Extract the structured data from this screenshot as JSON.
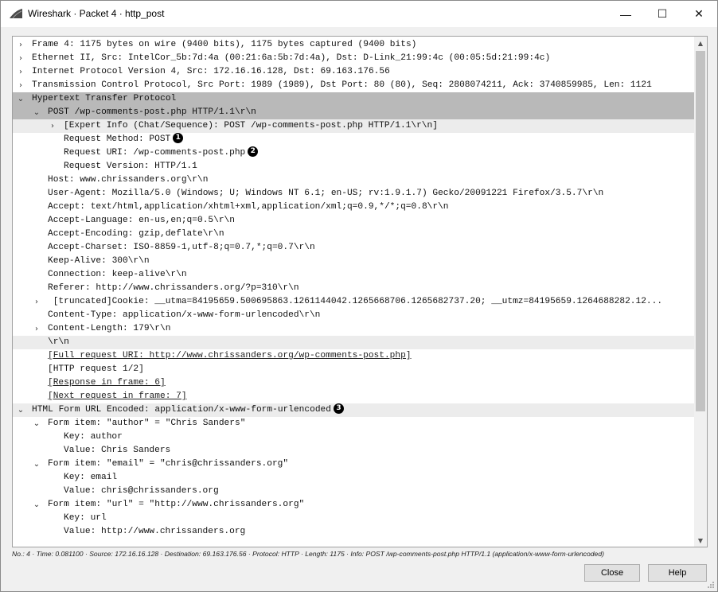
{
  "window": {
    "title": "Wireshark · Packet 4 · http_post",
    "icon": "wireshark-fin-icon",
    "controls": {
      "minimize": "—",
      "maximize": "☐",
      "close": "✕"
    }
  },
  "tree": {
    "rows": [
      {
        "indent": 0,
        "toggle": "›",
        "text": "Frame 4: 1175 bytes on wire (9400 bits), 1175 bytes captured (9400 bits)"
      },
      {
        "indent": 0,
        "toggle": "›",
        "text": "Ethernet II, Src: IntelCor_5b:7d:4a (00:21:6a:5b:7d:4a), Dst: D-Link_21:99:4c (00:05:5d:21:99:4c)"
      },
      {
        "indent": 0,
        "toggle": "›",
        "text": "Internet Protocol Version 4, Src: 172.16.16.128, Dst: 69.163.176.56"
      },
      {
        "indent": 0,
        "toggle": "›",
        "text": "Transmission Control Protocol, Src Port: 1989 (1989), Dst Port: 80 (80), Seq: 2808074211, Ack: 3740859985, Len: 1121"
      },
      {
        "indent": 0,
        "toggle": "⌄",
        "text": "Hypertext Transfer Protocol",
        "style": "sel"
      },
      {
        "indent": 1,
        "toggle": "⌄",
        "text": "POST /wp-comments-post.php HTTP/1.1\\r\\n",
        "style": "sel"
      },
      {
        "indent": 2,
        "toggle": "›",
        "text": "[Expert Info (Chat/Sequence): POST /wp-comments-post.php HTTP/1.1\\r\\n]",
        "style": "hl"
      },
      {
        "indent": 2,
        "toggle": "",
        "text": "Request Method: POST",
        "marker": "1"
      },
      {
        "indent": 2,
        "toggle": "",
        "text": "Request URI: /wp-comments-post.php",
        "marker": "2"
      },
      {
        "indent": 2,
        "toggle": "",
        "text": "Request Version: HTTP/1.1"
      },
      {
        "indent": 1,
        "toggle": "",
        "text": "Host: www.chrissanders.org\\r\\n"
      },
      {
        "indent": 1,
        "toggle": "",
        "text": "User-Agent: Mozilla/5.0 (Windows; U; Windows NT 6.1; en-US; rv:1.9.1.7) Gecko/20091221 Firefox/3.5.7\\r\\n"
      },
      {
        "indent": 1,
        "toggle": "",
        "text": "Accept: text/html,application/xhtml+xml,application/xml;q=0.9,*/*;q=0.8\\r\\n"
      },
      {
        "indent": 1,
        "toggle": "",
        "text": "Accept-Language: en-us,en;q=0.5\\r\\n"
      },
      {
        "indent": 1,
        "toggle": "",
        "text": "Accept-Encoding: gzip,deflate\\r\\n"
      },
      {
        "indent": 1,
        "toggle": "",
        "text": "Accept-Charset: ISO-8859-1,utf-8;q=0.7,*;q=0.7\\r\\n"
      },
      {
        "indent": 1,
        "toggle": "",
        "text": "Keep-Alive: 300\\r\\n"
      },
      {
        "indent": 1,
        "toggle": "",
        "text": "Connection: keep-alive\\r\\n"
      },
      {
        "indent": 1,
        "toggle": "",
        "text": "Referer: http://www.chrissanders.org/?p=310\\r\\n"
      },
      {
        "indent": 1,
        "toggle": "›",
        "text": " [truncated]Cookie: __utma=84195659.500695863.1261144042.1265668706.1265682737.20; __utmz=84195659.1264688282.12..."
      },
      {
        "indent": 1,
        "toggle": "",
        "text": "Content-Type: application/x-www-form-urlencoded\\r\\n"
      },
      {
        "indent": 1,
        "toggle": "›",
        "text": "Content-Length: 179\\r\\n"
      },
      {
        "indent": 1,
        "toggle": "",
        "text": "\\r\\n",
        "style": "hl"
      },
      {
        "indent": 1,
        "toggle": "",
        "text": "[Full request URI: http://www.chrissanders.org/wp-comments-post.php]",
        "link": true
      },
      {
        "indent": 1,
        "toggle": "",
        "text": "[HTTP request 1/2]"
      },
      {
        "indent": 1,
        "toggle": "",
        "text": "[Response in frame: 6]",
        "link": true
      },
      {
        "indent": 1,
        "toggle": "",
        "text": "[Next request in frame: 7]",
        "link": true
      },
      {
        "indent": 0,
        "toggle": "⌄",
        "text": "HTML Form URL Encoded: application/x-www-form-urlencoded",
        "marker": "3",
        "style": "hl"
      },
      {
        "indent": 1,
        "toggle": "⌄",
        "text": "Form item: \"author\" = \"Chris Sanders\""
      },
      {
        "indent": 2,
        "toggle": "",
        "text": "Key: author"
      },
      {
        "indent": 2,
        "toggle": "",
        "text": "Value: Chris Sanders"
      },
      {
        "indent": 1,
        "toggle": "⌄",
        "text": "Form item: \"email\" = \"chris@chrissanders.org\""
      },
      {
        "indent": 2,
        "toggle": "",
        "text": "Key: email"
      },
      {
        "indent": 2,
        "toggle": "",
        "text": "Value: chris@chrissanders.org"
      },
      {
        "indent": 1,
        "toggle": "⌄",
        "text": "Form item: \"url\" = \"http://www.chrissanders.org\""
      },
      {
        "indent": 2,
        "toggle": "",
        "text": "Key: url"
      },
      {
        "indent": 2,
        "toggle": "",
        "text": "Value: http://www.chrissanders.org"
      }
    ]
  },
  "scrollbar": {
    "up": "▲",
    "down": "▼"
  },
  "status_line": "No.: 4 · Time: 0.081100 · Source: 172.16.16.128 · Destination: 69.163.176.56 · Protocol: HTTP · Length: 1175 · Info: POST /wp-comments-post.php HTTP/1.1 (application/x-www-form-urlencoded)",
  "buttons": {
    "close_label": "Close",
    "help_label": "Help"
  },
  "colors": {
    "selected_row": "#b9b9b9",
    "highlight_row": "#ececec",
    "marker": "#000000"
  }
}
